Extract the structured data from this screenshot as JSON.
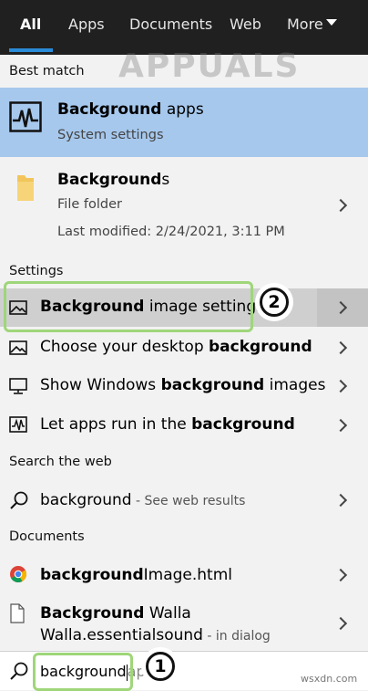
{
  "tabs": [
    {
      "label": "All",
      "active": true
    },
    {
      "label": "Apps"
    },
    {
      "label": "Documents"
    },
    {
      "label": "Web"
    },
    {
      "label": "More"
    }
  ],
  "sections": {
    "best_match": "Best match",
    "settings": "Settings",
    "search_web": "Search the web",
    "documents": "Documents"
  },
  "best_match": {
    "title_bold": "Background",
    "title_rest": " apps",
    "subtitle": "System settings"
  },
  "folder_result": {
    "title_bold": "Background",
    "title_rest": "s",
    "type": "File folder",
    "modified": "Last modified: 2/24/2021, 3:11 PM"
  },
  "settings_items": [
    {
      "pre": "",
      "bold": "Background",
      "post": " image settings",
      "icon": "image-icon"
    },
    {
      "pre": "Choose your desktop ",
      "bold": "background",
      "post": "",
      "icon": "image-icon"
    },
    {
      "pre": "Show Windows ",
      "bold": "background",
      "post": " images",
      "icon": "monitor-icon"
    },
    {
      "pre": "Let apps run in the ",
      "bold": "background",
      "post": "",
      "icon": "activity-icon"
    }
  ],
  "web_item": {
    "query": "background",
    "suffix": " - See web results"
  },
  "documents": [
    {
      "bold": "background",
      "rest": "Image.html"
    },
    {
      "bold": "Background",
      "line1_rest": " Walla",
      "line2": "Walla.essentialsound",
      "suffix": " - in dialog"
    }
  ],
  "search": {
    "value": "background",
    "ghost": "ap"
  },
  "annotations": {
    "step1": "1",
    "step2": "2"
  },
  "watermark": {
    "text": "APPUALS",
    "site": "wsxdn.com"
  },
  "colors": {
    "accent": "#2a8bd8",
    "highlight": "#a6c8ed",
    "annotation_green": "#9fd67a"
  }
}
